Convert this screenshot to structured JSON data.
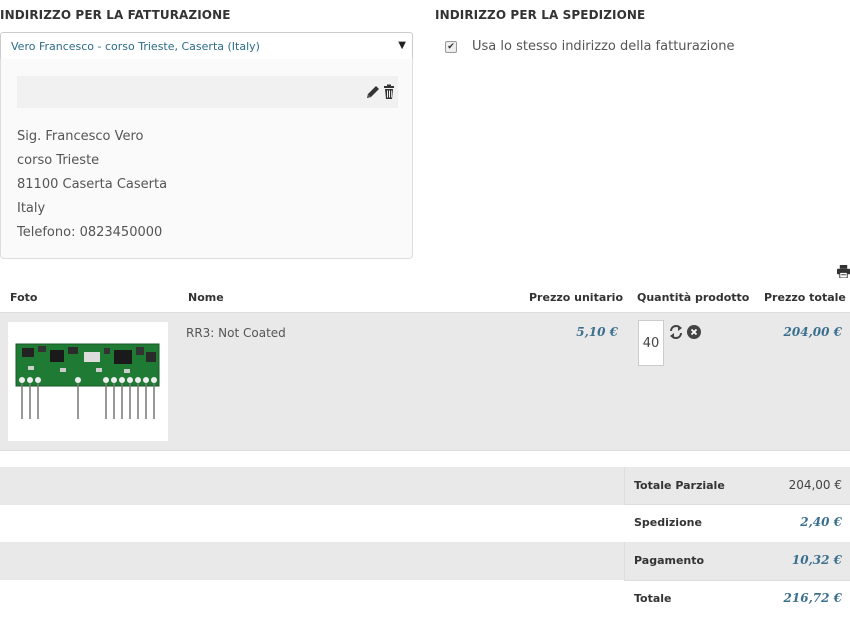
{
  "billing": {
    "title": "INDIRIZZO PER LA FATTURAZIONE",
    "selected_address": "Vero Francesco - corso Trieste, Caserta (Italy)",
    "lines": [
      "Sig. Francesco Vero",
      "corso Trieste",
      "81100 Caserta Caserta",
      "Italy",
      "Telefono: 0823450000"
    ],
    "edit_icon": "pencil-icon",
    "delete_icon": "trash-icon"
  },
  "shipping": {
    "title": "INDIRIZZO PER LA SPEDIZIONE",
    "same_as_billing_label": "Usa lo stesso indirizzo della fatturazione",
    "same_as_billing_checked": true
  },
  "cart": {
    "print_icon": "printer-icon",
    "headers": {
      "photo": "Foto",
      "name": "Nome",
      "unit_price": "Prezzo unitario",
      "quantity": "Quantità prodotto",
      "total_price": "Prezzo totale"
    },
    "items": [
      {
        "name": "RR3: Not Coated",
        "unit_price": "5,10 €",
        "quantity": "40",
        "total_price": "204,00 €",
        "refresh_icon": "refresh-icon",
        "remove_icon": "remove-icon"
      }
    ]
  },
  "totals": {
    "subtotal_label": "Totale Parziale",
    "subtotal_value": "204,00 €",
    "shipping_label": "Spedizione",
    "shipping_value": "2,40 €",
    "payment_label": "Pagamento",
    "payment_value": "10,32 €",
    "total_label": "Totale",
    "total_value": "216,72 €"
  },
  "colors": {
    "accent": "#3a6f8e",
    "row_shade": "#e9e9e9",
    "pcb_green": "#1f8a3a"
  }
}
